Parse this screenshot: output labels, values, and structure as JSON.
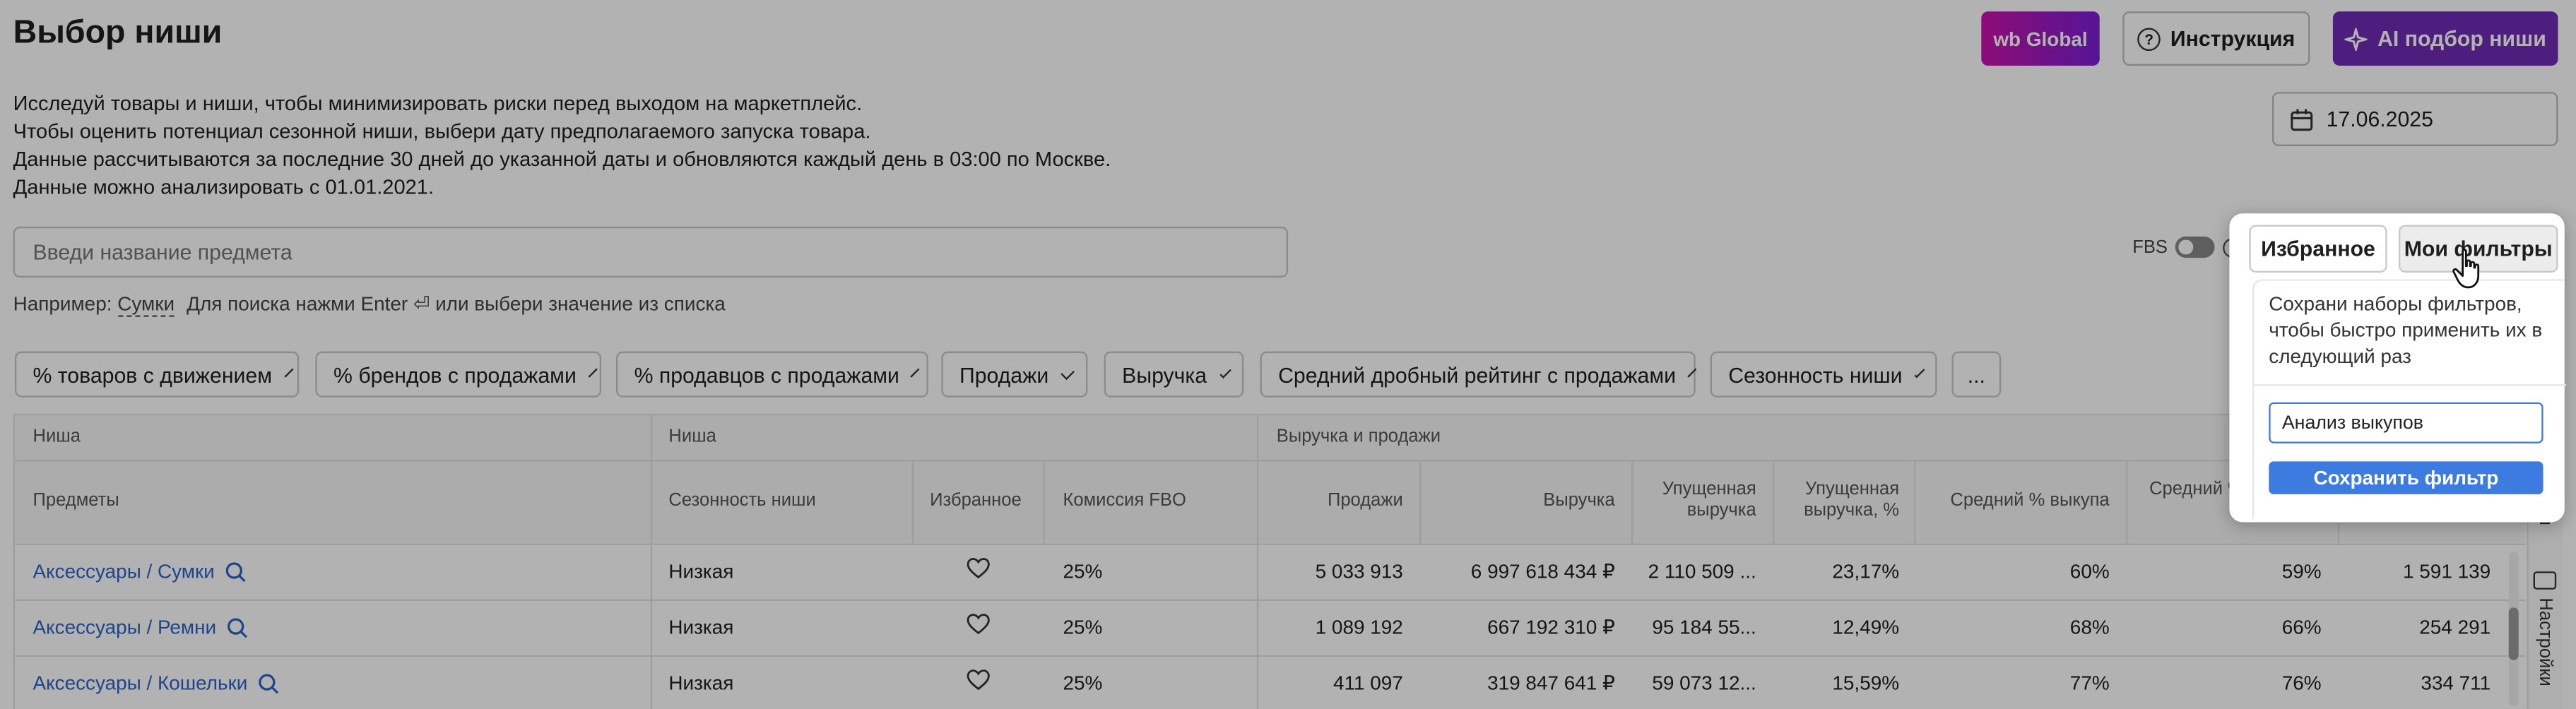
{
  "page": {
    "title": "Выбор ниши"
  },
  "header_buttons": {
    "wb_global": "wb Global",
    "instruction": "Инструкция",
    "ai": "AI подбор ниши"
  },
  "date": {
    "value": "17.06.2025"
  },
  "description": [
    "Исследуй товары и ниши, чтобы минимизировать риски перед выходом на маркетплейс.",
    "Чтобы оценить потенциал сезонной ниши, выбери дату предполагаемого запуска товара.",
    "Данные рассчитываются за последние 30 дней до указанной даты и обновляются каждый день в 03:00 по Москве.",
    "Данные можно анализировать с 01.01.2021."
  ],
  "search": {
    "placeholder": "Введи название предмета",
    "hint_prefix": "Например:",
    "hint_example": "Сумки",
    "hint_suffix": "Для поиска нажми Enter ⏎ или выбери значение из списка"
  },
  "fbs": {
    "label": "FBS",
    "help": "?"
  },
  "filters": [
    "% товаров с движением",
    "% брендов с продажами",
    "% продавцов с продажами",
    "Продажи",
    "Выручка",
    "Средний дробный рейтинг с продажами",
    "Сезонность ниши"
  ],
  "more_filters": "...",
  "table": {
    "group_headers": {
      "g1": "Ниша",
      "g2": "Ниша",
      "g3": "Выручка и продажи"
    },
    "columns": {
      "subjects": "Предметы",
      "seasonality": "Сезонность ниши",
      "favorite": "Избранное",
      "commission": "Комиссия FBO",
      "sales": "Продажи",
      "revenue": "Выручка",
      "lost_revenue": "Упущенная выручка",
      "lost_revenue_pct": "Упущенная выручка, %",
      "buyout": "Средний % выкупа",
      "buyout_returns": "Средний % с учетом возвратов"
    },
    "rows": [
      {
        "subject": "Аксессуары / Сумки",
        "seasonality": "Низкая",
        "commission": "25%",
        "sales": "5 033 913",
        "revenue": "6 997 618 434 ₽",
        "lost_revenue": "2 110 509 ...",
        "lost_pct": "23,17%",
        "buyout": "60%",
        "buyout_ret": "59%",
        "extra": "1 591 139"
      },
      {
        "subject": "Аксессуары / Ремни",
        "seasonality": "Низкая",
        "commission": "25%",
        "sales": "1 089 192",
        "revenue": "667 192 310 ₽",
        "lost_revenue": "95 184 55...",
        "lost_pct": "12,49%",
        "buyout": "68%",
        "buyout_ret": "66%",
        "extra": "254 291"
      },
      {
        "subject": "Аксессуары / Кошельки",
        "seasonality": "Низкая",
        "commission": "25%",
        "sales": "411 097",
        "revenue": "319 847 641 ₽",
        "lost_revenue": "59 073 12...",
        "lost_pct": "15,59%",
        "buyout": "77%",
        "buyout_ret": "76%",
        "extra": "334 711"
      }
    ]
  },
  "side_tabs": {
    "tab1": "ы",
    "settings": "Настройки"
  },
  "popup": {
    "tab_favorites": "Избранное",
    "tab_my_filters": "Мои фильтры",
    "text": "Сохрани наборы фильтров, чтобы быстро применить их в следующий раз",
    "input_value": "Анализ выкупов",
    "save_button": "Сохранить фильтр"
  },
  "colors": {
    "accent": "#3d7be0",
    "brand_purple": "#6f2bb5",
    "link": "#2b63c9"
  }
}
